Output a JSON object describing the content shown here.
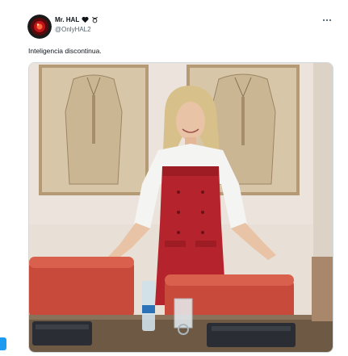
{
  "tweet": {
    "author_name": "Mr. HAL",
    "author_handle": "@OnlyHAL2",
    "text": "Inteligencia discontinua.",
    "icons": {
      "verified": "heart-icon",
      "extra": "taurus-icon",
      "more": "more-horizontal-icon",
      "avatar": "hal-eye-avatar"
    }
  },
  "colors": {
    "accent": "#1d9bf0",
    "dress": "#b5242c",
    "chair": "#c84a3a",
    "wall": "#e9e0d8"
  }
}
